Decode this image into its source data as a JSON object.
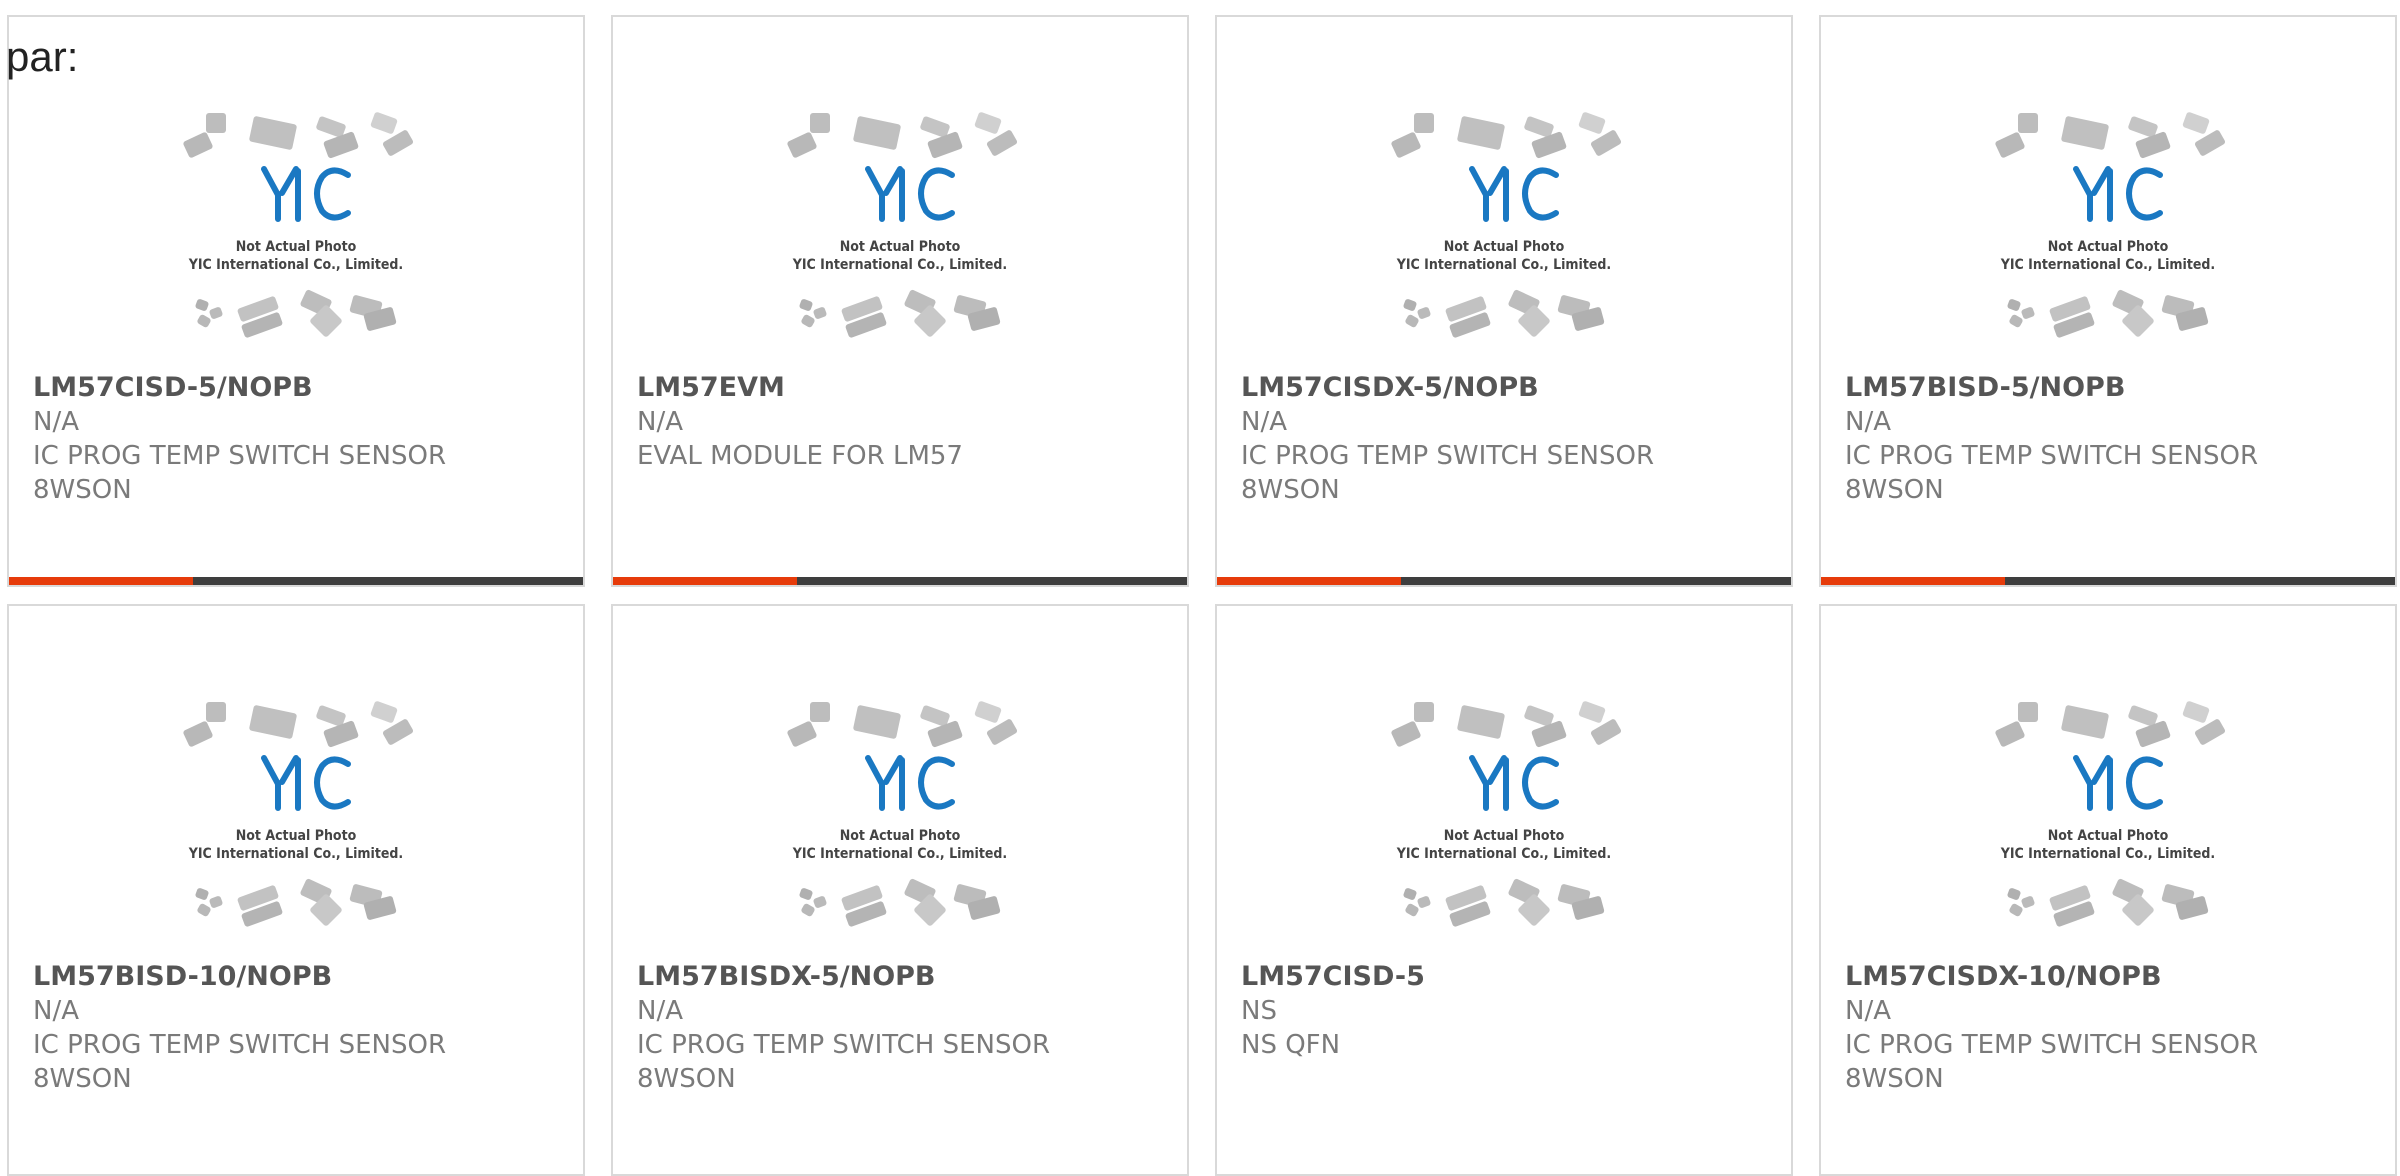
{
  "lead_text": "par:",
  "thumbnail": {
    "caption_line1": "Not Actual Photo",
    "caption_line2": "YIC International Co., Limited.",
    "brand": "YIC"
  },
  "colors": {
    "accent": "#e63b0a",
    "bar_track": "#3e3e3e",
    "logo_blue": "#1a78c2",
    "border": "#d9d9d9"
  },
  "progress_fraction": 0.32,
  "products": [
    {
      "part_no": "LM57CISD-5/NOPB",
      "maker": "N/A",
      "desc": "IC PROG TEMP SWITCH SENSOR 8WSON",
      "show_bar": true
    },
    {
      "part_no": "LM57EVM",
      "maker": "N/A",
      "desc": "EVAL MODULE FOR LM57",
      "show_bar": true
    },
    {
      "part_no": "LM57CISDX-5/NOPB",
      "maker": "N/A",
      "desc": "IC PROG TEMP SWITCH SENSOR 8WSON",
      "show_bar": true
    },
    {
      "part_no": "LM57BISD-5/NOPB",
      "maker": "N/A",
      "desc": "IC PROG TEMP SWITCH SENSOR 8WSON",
      "show_bar": true
    },
    {
      "part_no": "LM57BISD-10/NOPB",
      "maker": "N/A",
      "desc": "IC PROG TEMP SWITCH SENSOR 8WSON",
      "show_bar": false
    },
    {
      "part_no": "LM57BISDX-5/NOPB",
      "maker": "N/A",
      "desc": "IC PROG TEMP SWITCH SENSOR 8WSON",
      "show_bar": false
    },
    {
      "part_no": "LM57CISD-5",
      "maker": "NS",
      "desc": "NS QFN",
      "show_bar": false
    },
    {
      "part_no": "LM57CISDX-10/NOPB",
      "maker": "N/A",
      "desc": "IC PROG TEMP SWITCH SENSOR 8WSON",
      "show_bar": false
    }
  ]
}
